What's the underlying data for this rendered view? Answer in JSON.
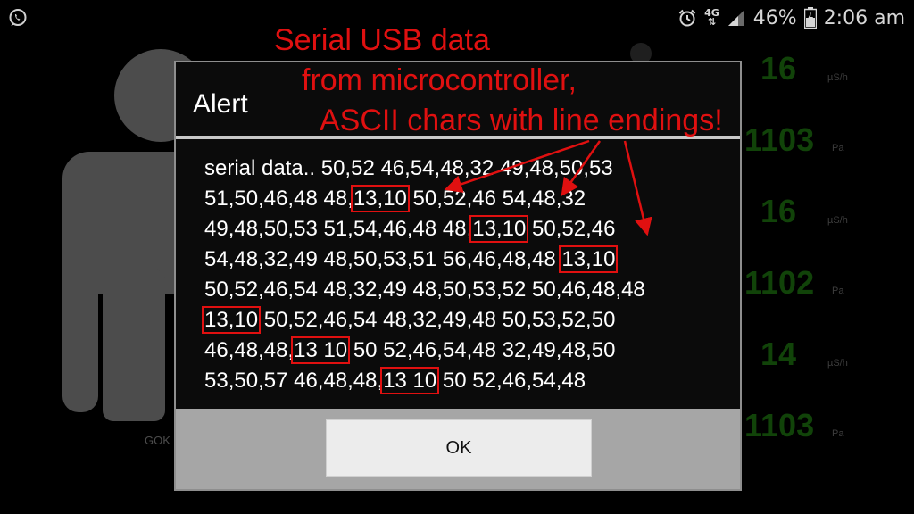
{
  "status_bar": {
    "battery_percent": "46%",
    "time": "2:06 am",
    "network": "4G",
    "icons": [
      "whatsapp-icon",
      "alarm-icon",
      "network-4g-icon",
      "signal-icon",
      "battery-icon"
    ]
  },
  "background_app": {
    "name_label": "GOK",
    "readings": [
      {
        "value": "16",
        "unit": "µS/h"
      },
      {
        "value": "1103",
        "unit": "Pa"
      },
      {
        "value": "16",
        "unit": "µS/h"
      },
      {
        "value": "1102",
        "unit": "Pa"
      },
      {
        "value": "14",
        "unit": "µS/h"
      },
      {
        "value": "1103",
        "unit": "Pa"
      }
    ]
  },
  "dialog": {
    "title": "Alert",
    "lines": [
      [
        "serial data.. 50,52 46,54,48,32 49,48,50,53"
      ],
      [
        "51,50,46,48 48,",
        "13,10",
        " 50,52,46 54,48,32"
      ],
      [
        "49,48,50,53 51,54,46,48 48,",
        "13,10",
        " 50,52,46"
      ],
      [
        "54,48,32,49 48,50,53,51 56,46,48,48 ",
        "13,10"
      ],
      [
        "50,52,46,54 48,32,49 48,50,53,52 50,46,48,48"
      ],
      [
        "",
        "13,10",
        " 50,52,46,54 48,32,49,48 50,53,52,50"
      ],
      [
        "46,48,48,",
        "13 10",
        " 50 52,46,54,48 32,49,48,50"
      ],
      [
        "53,50,57 46,48,48,",
        "13 10",
        " 50 52,46,54,48"
      ]
    ],
    "ok_label": "OK"
  },
  "annotation": {
    "line1": "Serial USB data",
    "line2": "from microcontroller,",
    "line3": "ASCII chars with line endings!",
    "color": "#e01010"
  },
  "colors": {
    "reading_green": "#1f7a12",
    "highlight_red": "#e01010",
    "dialog_footer": "#a6a6a6"
  }
}
